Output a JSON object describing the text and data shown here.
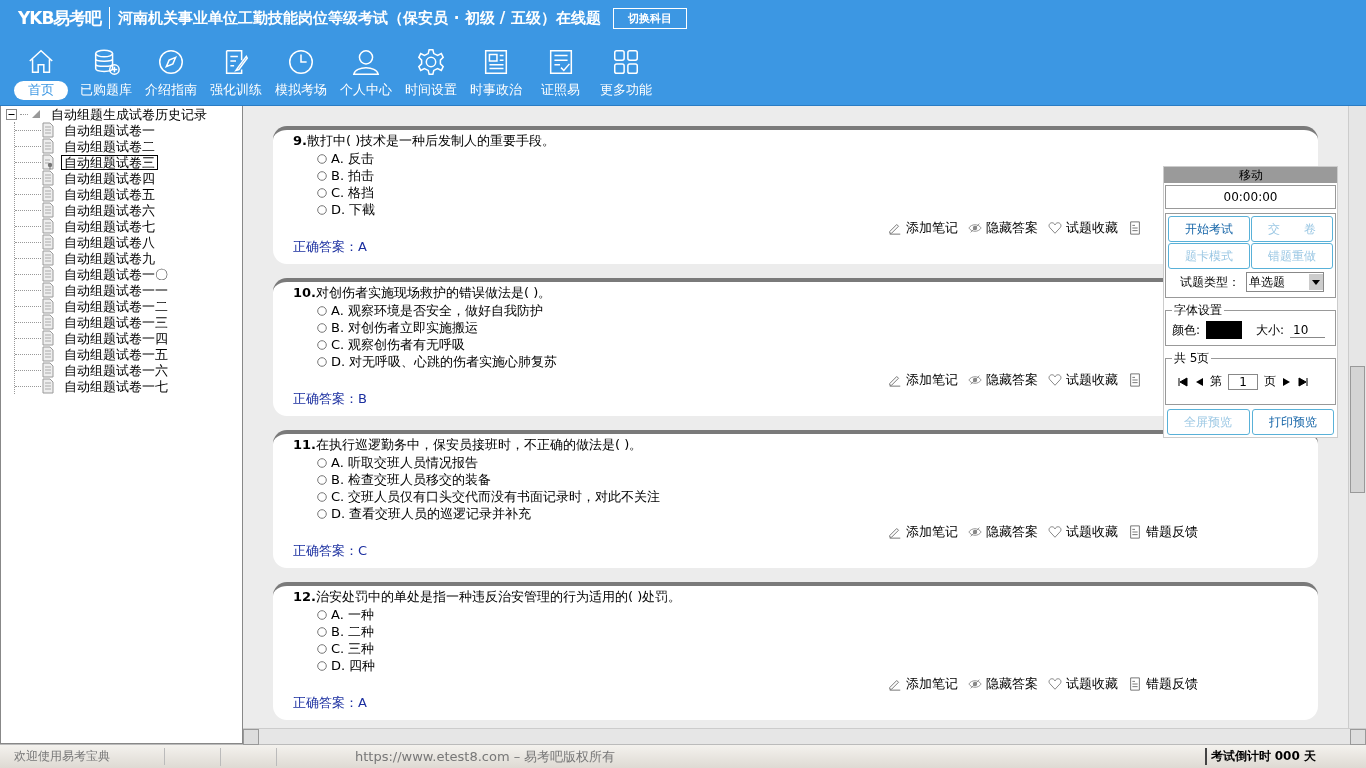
{
  "header": {
    "logo": "YKB易考吧",
    "title": "河南机关事业单位工勤技能岗位等级考试（保安员 · 初级 / 五级）在线题",
    "switch_button": "切换科目"
  },
  "nav": [
    {
      "label": "首页",
      "selected": true
    },
    {
      "label": "已购题库",
      "selected": false
    },
    {
      "label": "介绍指南",
      "selected": false
    },
    {
      "label": "强化训练",
      "selected": false
    },
    {
      "label": "模拟考场",
      "selected": false
    },
    {
      "label": "个人中心",
      "selected": false
    },
    {
      "label": "时间设置",
      "selected": false
    },
    {
      "label": "时事政治",
      "selected": false
    },
    {
      "label": "证照易",
      "selected": false
    },
    {
      "label": "更多功能",
      "selected": false
    }
  ],
  "tree": {
    "label": "自动组题生成试卷历史记录",
    "expanded": true,
    "children": [
      {
        "label": "自动组题试卷一",
        "selected": false
      },
      {
        "label": "自动组题试卷二",
        "selected": false
      },
      {
        "label": "自动组题试卷三",
        "selected": true
      },
      {
        "label": "自动组题试卷四",
        "selected": false
      },
      {
        "label": "自动组题试卷五",
        "selected": false
      },
      {
        "label": "自动组题试卷六",
        "selected": false
      },
      {
        "label": "自动组题试卷七",
        "selected": false
      },
      {
        "label": "自动组题试卷八",
        "selected": false
      },
      {
        "label": "自动组题试卷九",
        "selected": false
      },
      {
        "label": "自动组题试卷一〇",
        "selected": false
      },
      {
        "label": "自动组题试卷一一",
        "selected": false
      },
      {
        "label": "自动组题试卷一二",
        "selected": false
      },
      {
        "label": "自动组题试卷一三",
        "selected": false
      },
      {
        "label": "自动组题试卷一四",
        "selected": false
      },
      {
        "label": "自动组题试卷一五",
        "selected": false
      },
      {
        "label": "自动组题试卷一六",
        "selected": false
      },
      {
        "label": "自动组题试卷一七",
        "selected": false
      }
    ]
  },
  "questions": [
    {
      "number": "9.",
      "text": "散打中( )技术是一种后发制人的重要手段。",
      "options": [
        {
          "letter": "A.",
          "text": "反击",
          "selected": false
        },
        {
          "letter": "B.",
          "text": "拍击",
          "selected": false
        },
        {
          "letter": "C.",
          "text": "格挡",
          "selected": false
        },
        {
          "letter": "D.",
          "text": "下截",
          "selected": false
        }
      ],
      "actions": [
        {
          "kind": "note",
          "label": "添加笔记"
        },
        {
          "kind": "hide",
          "label": "隐藏答案"
        },
        {
          "kind": "favorite",
          "label": "试题收藏"
        },
        {
          "kind": "feedback"
        }
      ],
      "answer_label": "正确答案：",
      "answer": "A"
    },
    {
      "number": "10.",
      "text": "对创伤者实施现场救护的错误做法是( )。",
      "options": [
        {
          "letter": "A.",
          "text": "观察环境是否安全，做好自我防护",
          "selected": false
        },
        {
          "letter": "B.",
          "text": "对创伤者立即实施搬运",
          "selected": false
        },
        {
          "letter": "C.",
          "text": "观察创伤者有无呼吸",
          "selected": false
        },
        {
          "letter": "D.",
          "text": "对无呼吸、心跳的伤者实施心肺复苏",
          "selected": false
        }
      ],
      "actions": [
        {
          "kind": "note",
          "label": "添加笔记"
        },
        {
          "kind": "hide",
          "label": "隐藏答案"
        },
        {
          "kind": "favorite",
          "label": "试题收藏"
        },
        {
          "kind": "feedback"
        }
      ],
      "answer_label": "正确答案：",
      "answer": "B"
    },
    {
      "number": "11.",
      "text": "在执行巡逻勤务中，保安员接班时，不正确的做法是( )。",
      "options": [
        {
          "letter": "A.",
          "text": "听取交班人员情况报告",
          "selected": false
        },
        {
          "letter": "B.",
          "text": "检查交班人员移交的装备",
          "selected": false
        },
        {
          "letter": "C.",
          "text": "交班人员仅有口头交代而没有书面记录时，对此不关注",
          "selected": false
        },
        {
          "letter": "D.",
          "text": "查看交班人员的巡逻记录并补充",
          "selected": false
        }
      ],
      "actions": [
        {
          "kind": "note",
          "label": "添加笔记"
        },
        {
          "kind": "hide",
          "label": "隐藏答案"
        },
        {
          "kind": "favorite",
          "label": "试题收藏"
        },
        {
          "kind": "feedback",
          "label": "错题反馈"
        }
      ],
      "answer_label": "正确答案：",
      "answer": "C"
    },
    {
      "number": "12.",
      "text": "治安处罚中的单处是指一种违反治安管理的行为适用的( )处罚。",
      "options": [
        {
          "letter": "A.",
          "text": "一种",
          "selected": false
        },
        {
          "letter": "B.",
          "text": "二种",
          "selected": false
        },
        {
          "letter": "C.",
          "text": "三种",
          "selected": false
        },
        {
          "letter": "D.",
          "text": "四种",
          "selected": false
        }
      ],
      "actions": [
        {
          "kind": "note",
          "label": "添加笔记"
        },
        {
          "kind": "hide",
          "label": "隐藏答案"
        },
        {
          "kind": "favorite",
          "label": "试题收藏"
        },
        {
          "kind": "feedback",
          "label": "错题反馈"
        }
      ],
      "answer_label": "正确答案：",
      "answer": "A"
    }
  ],
  "panel": {
    "title": "移动",
    "timer": "00:00:00",
    "buttons": [
      {
        "label": "开始考试",
        "disabled": false
      },
      {
        "label": "交　　卷",
        "disabled": true
      },
      {
        "label": "题卡模式",
        "disabled": true
      },
      {
        "label": "错题重做",
        "disabled": true
      }
    ],
    "type_label": "试题类型：",
    "type_value": "单选题",
    "font_group": "字体设置",
    "color_label": "颜色:",
    "size_label": "大小:",
    "size_value": "10",
    "page_group": "共 5页",
    "page_prefix": "第",
    "page_value": "1",
    "page_suffix": "页",
    "bottom_buttons": [
      {
        "label": "全屏预览",
        "disabled": true
      },
      {
        "label": "打印预览",
        "disabled": false
      }
    ]
  },
  "status": {
    "welcome": "欢迎使用易考宝典",
    "copyright": "https://www.etest8.com – 易考吧版权所有",
    "countdown": "考试倒计时 000 天"
  }
}
